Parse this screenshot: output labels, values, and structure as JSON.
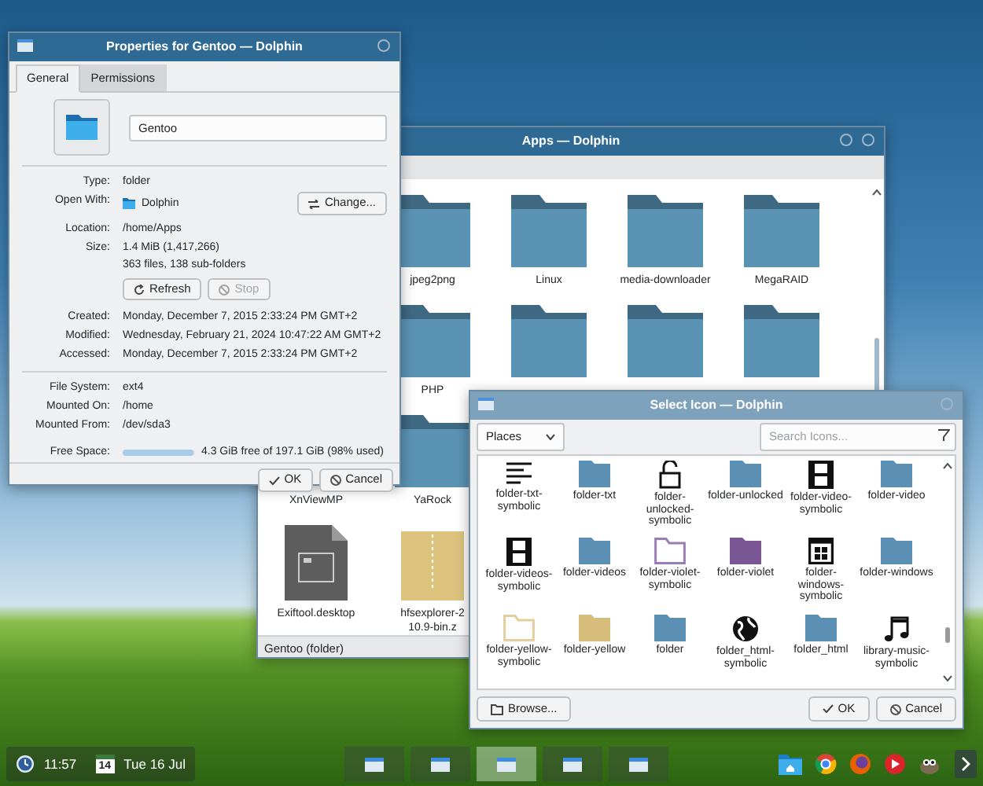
{
  "apps_window": {
    "title": "Apps — Dolphin",
    "files": [
      [
        {
          "kind": "none"
        },
        {
          "kind": "folder",
          "label": "jpeg2png"
        },
        {
          "kind": "folder",
          "label": "Linux"
        },
        {
          "kind": "folder",
          "label": "media-downloader"
        },
        {
          "kind": "folder",
          "label": "MegaRAID"
        }
      ],
      [
        {
          "kind": "none"
        },
        {
          "kind": "folder",
          "label": "PHP"
        },
        {
          "kind": "folder"
        },
        {
          "kind": "folder"
        },
        {
          "kind": "folder"
        }
      ],
      [
        {
          "kind": "none",
          "label": "XnViewMP"
        },
        {
          "kind": "folder",
          "label": "YaRock"
        },
        {
          "kind": "none"
        },
        {
          "kind": "none"
        },
        {
          "kind": "none"
        }
      ],
      [
        {
          "kind": "desktop",
          "label": "Exiftool.desktop"
        },
        {
          "kind": "archive",
          "label": "hfsexplorer-2\n10.9-bin.z"
        },
        {
          "kind": "none"
        },
        {
          "kind": "none"
        },
        {
          "kind": "none"
        }
      ]
    ],
    "status": "Gentoo (folder)"
  },
  "properties_window": {
    "title": "Properties for Gentoo — Dolphin",
    "tabs": [
      {
        "label": "General",
        "selected": true
      },
      {
        "label": "Permissions",
        "selected": false
      }
    ],
    "name_field": {
      "value": "Gentoo"
    },
    "general_rows": [
      {
        "label": "Type:",
        "lines": [
          "folder"
        ]
      },
      {
        "label": "Open With:",
        "app": "Dolphin",
        "button": "Change..."
      },
      {
        "label": "Location:",
        "lines": [
          "/home/Apps"
        ]
      },
      {
        "label": "Size:",
        "lines": [
          "1.4 MiB (1,417,266)",
          "363 files, 138 sub-folders"
        ]
      }
    ],
    "size_buttons": [
      {
        "label": "Refresh",
        "kind": "refresh",
        "disabled": false
      },
      {
        "label": "Stop",
        "kind": "stop",
        "disabled": true
      }
    ],
    "time_rows": [
      {
        "label": "Created:",
        "lines": [
          "Monday, December 7, 2015 2:33:24 PM GMT+2"
        ]
      },
      {
        "label": "Modified:",
        "lines": [
          "Wednesday, February 21, 2024 10:47:22 AM GMT+2"
        ]
      },
      {
        "label": "Accessed:",
        "lines": [
          "Monday, December 7, 2015 2:33:24 PM GMT+2"
        ]
      }
    ],
    "fs_rows": [
      {
        "label": "File System:",
        "lines": [
          "ext4"
        ]
      },
      {
        "label": "Mounted On:",
        "lines": [
          "/home"
        ]
      },
      {
        "label": "Mounted From:",
        "lines": [
          "/dev/sda3"
        ]
      }
    ],
    "free_space": {
      "label": "Free Space:",
      "level": 0.98,
      "reading": "4.3 GiB free of 197.1 GiB (98% used)"
    },
    "buttons": [
      {
        "label": "OK",
        "kind": "ok"
      },
      {
        "label": "Cancel",
        "kind": "cancel"
      }
    ]
  },
  "select_icon_dialog": {
    "title": "Select Icon — Dolphin",
    "source": {
      "value": "Places"
    },
    "search": {
      "placeholder": "Search Icons..."
    },
    "icons": [
      {
        "label": "folder-txt-symbolic",
        "kind": "lines"
      },
      {
        "label": "folder-txt",
        "kind": "folder",
        "color": "#5b8fb3"
      },
      {
        "label": "folder-unlocked-symbolic",
        "kind": "padlock"
      },
      {
        "label": "folder-unlocked",
        "kind": "folder",
        "color": "#5b8fb3"
      },
      {
        "label": "folder-video-symbolic",
        "kind": "film"
      },
      {
        "label": "folder-video",
        "kind": "folder",
        "color": "#5b8fb3"
      },
      {
        "label": "folder-videos-symbolic",
        "kind": "film"
      },
      {
        "label": "folder-videos",
        "kind": "folder",
        "color": "#5b8fb3"
      },
      {
        "label": "folder-violet-symbolic",
        "kind": "outline",
        "color": "#9c7db8"
      },
      {
        "label": "folder-violet",
        "kind": "folder",
        "color": "#7b5695"
      },
      {
        "label": "folder-windows-symbolic",
        "kind": "window"
      },
      {
        "label": "folder-windows",
        "kind": "folder",
        "color": "#5b8fb3"
      },
      {
        "label": "folder-yellow-symbolic",
        "kind": "outline",
        "color": "#e2cf9f"
      },
      {
        "label": "folder-yellow",
        "kind": "folder",
        "color": "#d8be7c"
      },
      {
        "label": "folder",
        "kind": "folder",
        "color": "#5b8fb3"
      },
      {
        "label": "folder_html-symbolic",
        "kind": "globe"
      },
      {
        "label": "folder_html",
        "kind": "folder",
        "color": "#5b8fb3"
      },
      {
        "label": "library-music-symbolic",
        "kind": "music"
      }
    ],
    "buttons": [
      {
        "label": "Browse...",
        "kind": "browse"
      },
      {
        "label": "OK",
        "kind": "ok"
      },
      {
        "label": "Cancel",
        "kind": "cancel"
      }
    ]
  },
  "taskbar": {
    "time": "11:57",
    "calendar_day": "14",
    "date": "Tue 16 Jul",
    "tasks": [
      {
        "selected": false
      },
      {
        "selected": false
      },
      {
        "selected": true
      },
      {
        "selected": false
      },
      {
        "selected": false
      }
    ]
  }
}
